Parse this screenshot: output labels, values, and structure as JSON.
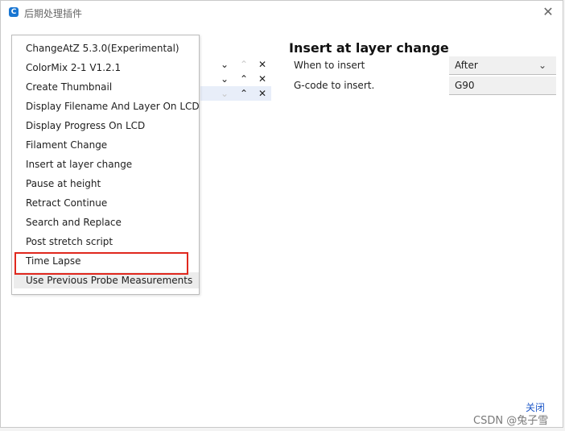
{
  "window": {
    "title": "后期处理插件",
    "app_icon": "C",
    "close_glyph": "✕"
  },
  "active_scripts": [
    {
      "down": "⌄",
      "up": "⌃",
      "remove": "✕"
    },
    {
      "down": "⌄",
      "up": "⌃",
      "remove": "✕"
    },
    {
      "down": "⌄",
      "up": "⌃",
      "remove": "✕"
    }
  ],
  "dropdown": {
    "items": [
      "ChangeAtZ 5.3.0(Experimental)",
      "ColorMix 2-1 V1.2.1",
      "Create Thumbnail",
      "Display Filename And Layer On LCD",
      "Display Progress On LCD",
      "Filament Change",
      "Insert at layer change",
      "Pause at height",
      "Retract Continue",
      "Search and Replace",
      "Post stretch script",
      "Time Lapse",
      "Use Previous Probe Measurements"
    ],
    "highlighted": "Time Lapse",
    "hovered": "Use Previous Probe Measurements",
    "highlight_color": "#e0281e"
  },
  "settings": {
    "title": "Insert at layer change",
    "when_to_insert_label": "When to insert",
    "when_to_insert_value": "After",
    "gcode_label": "G-code to insert.",
    "gcode_value": "G90"
  },
  "footer": {
    "close_label": "关闭"
  },
  "watermark": "CSDN @兔子雪"
}
